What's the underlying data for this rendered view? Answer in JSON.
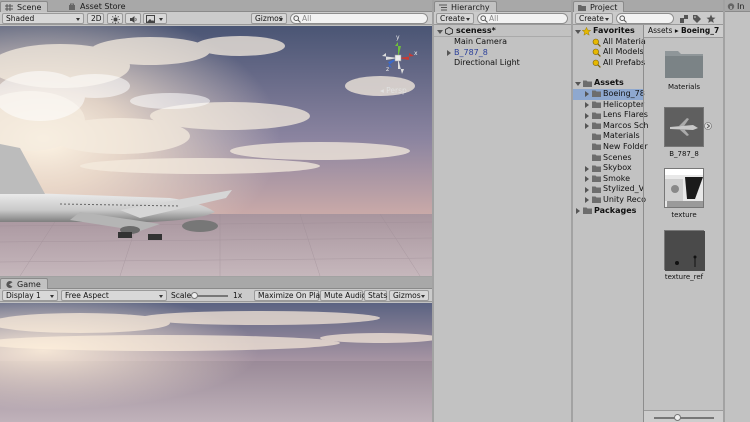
{
  "scene": {
    "tabs": [
      "Scene",
      "Asset Store"
    ],
    "shading_mode": "Shaded",
    "toggle_2d": "2D",
    "gizmos_label": "Gizmos",
    "search_placeholder": "All",
    "projection_label": "Persp",
    "axes": {
      "y": "y",
      "x": "x",
      "z": "z"
    }
  },
  "game": {
    "tab": "Game",
    "display": "Display 1",
    "aspect": "Free Aspect",
    "scale_label": "Scale",
    "scale_value": "1x",
    "maximize_on_play": "Maximize On Play",
    "mute_audio": "Mute Audio",
    "stats": "Stats",
    "gizmos_label": "Gizmos"
  },
  "hierarchy": {
    "tab": "Hierarchy",
    "create_label": "Create",
    "search_placeholder": "All",
    "scene_name": "sceness*",
    "items": [
      "Main Camera",
      "B_787_8",
      "Directional Light"
    ]
  },
  "project": {
    "tab": "Project",
    "create_label": "Create",
    "favorites_label": "Favorites",
    "favorites": [
      "All Materia",
      "All Models",
      "All Prefabs"
    ],
    "assets_label": "Assets",
    "asset_folders": [
      "Boeing_78",
      "Helicopter",
      "Lens Flares",
      "Marcos Sch",
      "Materials",
      "New Folder",
      "Scenes",
      "Skybox",
      "Smoke",
      "Stylized_V",
      "Unity Reco"
    ],
    "packages_label": "Packages",
    "breadcrumb": [
      "Assets",
      "Boeing_7"
    ],
    "grid_items": [
      "Materials",
      "B_787_8",
      "texture",
      "texture_ref"
    ]
  },
  "inspector": {
    "tab_partial": "In"
  },
  "colors": {
    "panel": "#c2c2c2",
    "selection": "#8ea8cf",
    "tabbar": "#a8a8a8"
  }
}
